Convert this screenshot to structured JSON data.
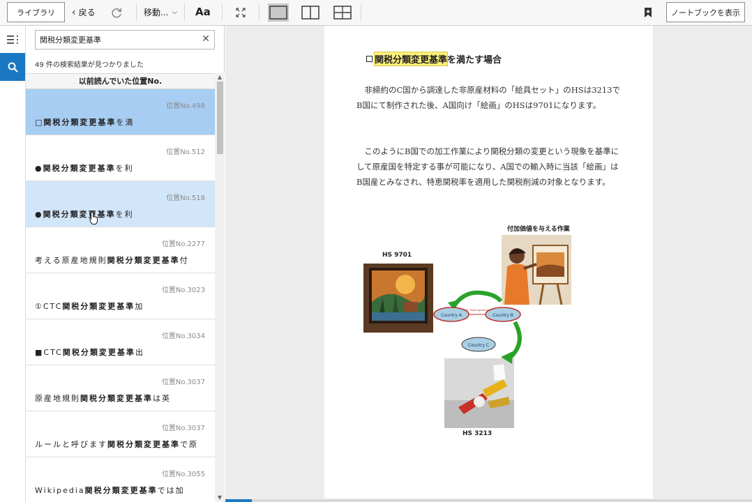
{
  "toolbar": {
    "library_label": "ライブラリ",
    "back_label": "戻る",
    "move_label": "移動...",
    "font_label": "Aa",
    "notebook_label": "ノートブックを表示"
  },
  "search": {
    "value": "関税分類変更基準",
    "result_count": "49 件の検索結果が見つかりました",
    "previous_position_header": "以前読んでいた位置No."
  },
  "results": [
    {
      "location": "位置No.498",
      "prefix": "□",
      "match": "関税分類変更基準",
      "suffix": "を満"
    },
    {
      "location": "位置No.512",
      "prefix": "●",
      "match": "関税分類変更基準",
      "suffix": "を利"
    },
    {
      "location": "位置No.518",
      "prefix": "●",
      "match": "関税分類変更基準",
      "suffix": "を利"
    },
    {
      "location": "位置No.2277",
      "prefix": "考える原産地規則",
      "match": "関税分類変更基準",
      "suffix": "付"
    },
    {
      "location": "位置No.3023",
      "prefix": "①CTC",
      "match": "関税分類変更基準",
      "suffix": "加"
    },
    {
      "location": "位置No.3034",
      "prefix": "■CTC",
      "match": "関税分類変更基準",
      "suffix": "出"
    },
    {
      "location": "位置No.3037",
      "prefix": "原産地規則",
      "match": "関税分類変更基準",
      "suffix": "は英"
    },
    {
      "location": "位置No.3037",
      "prefix": "ルールと呼びます",
      "match": "関税分類変更基準",
      "suffix": "で原"
    },
    {
      "location": "位置No.3055",
      "prefix": "Wikipedia",
      "match": "関税分類変更基準",
      "suffix": "では加"
    }
  ],
  "book": {
    "heading_highlight": "関税分類変更基準",
    "heading_rest": "を満たす場合",
    "paragraph1": "非締約のC国から調達した非原産材料の「絵具セット」のHSは3213でB国にて制作された後、A国向け「絵画」のHSは9701になります。",
    "paragraph2": "このようにB国での加工作業により関税分類の変更という現象を基準にして原産国を特定する事が可能になり、A国での輸入時に当該「絵画」はB国産とみなされ、特恵関税率を適用した関税削減の対象となります。",
    "figure": {
      "label_top": "付加価値を与える作業",
      "label_hs9701": "HS 9701",
      "label_hs3213": "HS 3213",
      "country_a": "Country A",
      "country_b": "Country B",
      "country_c": "Country C",
      "fta_label": "Free Trade Agreement"
    }
  },
  "progress": 0.05,
  "colors": {
    "accent": "#1a78c2",
    "selected_row": "#a8cdf3",
    "hover_row": "#d2e6fa",
    "highlight": "#fff17a"
  }
}
